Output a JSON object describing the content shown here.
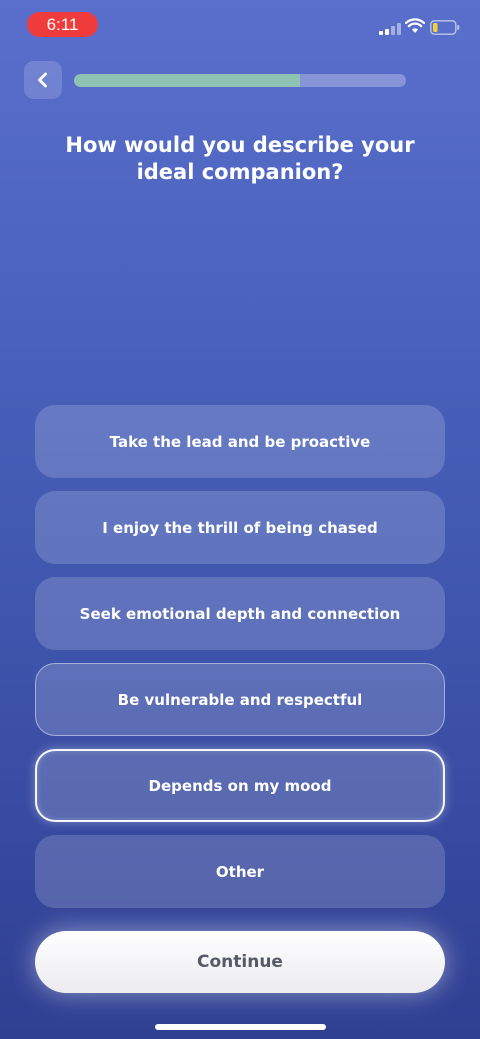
{
  "status_bar": {
    "time": "6:11",
    "icons": [
      "signal-icon",
      "wifi-icon",
      "battery-icon"
    ]
  },
  "header": {
    "back_icon": "chevron-left-icon",
    "progress": 0.68,
    "progress_color": "#8ec2b2"
  },
  "question": {
    "line1": "How would you describe your",
    "line2": "ideal companion?"
  },
  "options": [
    {
      "label": "Take the lead and be proactive",
      "state": "default"
    },
    {
      "label": "I enjoy the thrill of being chased",
      "state": "default"
    },
    {
      "label": "Seek emotional depth and connection",
      "state": "default"
    },
    {
      "label": "Be vulnerable and respectful",
      "state": "highlighted"
    },
    {
      "label": "Depends on my mood",
      "state": "selected"
    },
    {
      "label": "Other",
      "state": "default"
    }
  ],
  "continue_label": "Continue",
  "colors": {
    "background_top": "#5a6fcc",
    "background_bottom": "#2f3f92",
    "time_pill": "#ef3b3b"
  }
}
